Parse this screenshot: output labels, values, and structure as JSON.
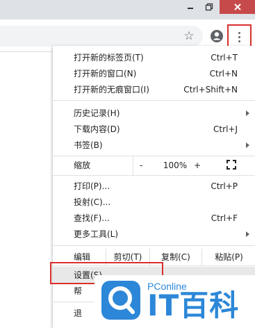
{
  "window_controls": {
    "minimize": "minimize",
    "maximize": "maximize",
    "close": "close"
  },
  "toolbar": {
    "bookmark_icon": "star-icon",
    "profile_icon": "account-icon",
    "menu_icon": "more-vert-icon"
  },
  "menu": {
    "new_tab": {
      "label": "打开新的标签页(T)",
      "shortcut": "Ctrl+T"
    },
    "new_window": {
      "label": "打开新的窗口(N)",
      "shortcut": "Ctrl+N"
    },
    "incognito": {
      "label": "打开新的无痕窗口(I)",
      "shortcut": "Ctrl+Shift+N"
    },
    "history": {
      "label": "历史记录(H)"
    },
    "downloads": {
      "label": "下载内容(D)",
      "shortcut": "Ctrl+J"
    },
    "bookmarks": {
      "label": "书签(B)"
    },
    "zoom": {
      "label": "缩放",
      "minus": "-",
      "value": "100%",
      "plus": "+"
    },
    "print": {
      "label": "打印(P)...",
      "shortcut": "Ctrl+P"
    },
    "cast": {
      "label": "投射(C)..."
    },
    "find": {
      "label": "查找(F)...",
      "shortcut": "Ctrl+F"
    },
    "more_tools": {
      "label": "更多工具(L)"
    },
    "edit": {
      "label": "编辑",
      "cut": "剪切(T)",
      "copy": "复制(C)",
      "paste": "粘贴(P)"
    },
    "settings": {
      "label": "设置(S)"
    },
    "help": {
      "label": "帮"
    },
    "exit": {
      "label": "退"
    }
  },
  "watermark": {
    "brand": "PConline",
    "title": "IT百科"
  },
  "colors": {
    "highlight_box": "#d9302c",
    "watermark": "#2c87d8",
    "close_button": "#c74a4a"
  }
}
